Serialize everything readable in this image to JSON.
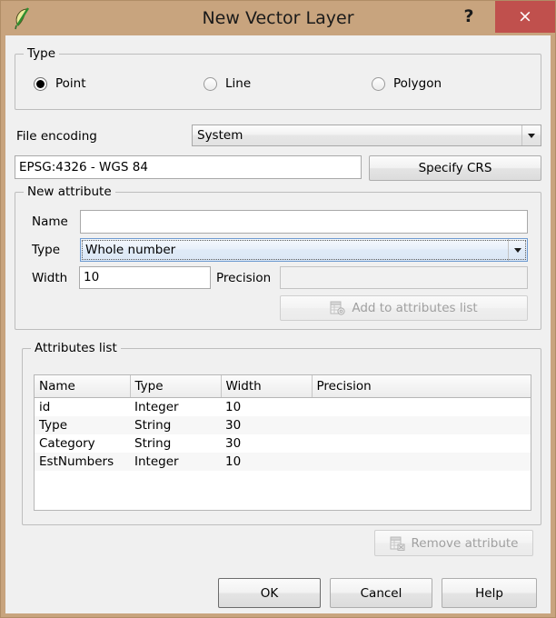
{
  "window": {
    "title": "New Vector Layer",
    "app_icon": "qgis-leaf-icon",
    "help_icon": "?",
    "close_icon": "×",
    "frame_color": "#c8a47e",
    "close_color": "#c0504d"
  },
  "type_group": {
    "title": "Type",
    "options": [
      {
        "label": "Point",
        "checked": true
      },
      {
        "label": "Line",
        "checked": false
      },
      {
        "label": "Polygon",
        "checked": false
      }
    ]
  },
  "encoding": {
    "label": "File encoding",
    "value": "System"
  },
  "crs": {
    "value": "EPSG:4326 - WGS 84",
    "button_label": "Specify CRS"
  },
  "new_attribute": {
    "title": "New attribute",
    "name_label": "Name",
    "name_value": "",
    "name_placeholder": "",
    "type_label": "Type",
    "type_value": "Whole number",
    "width_label": "Width",
    "width_value": "10",
    "precision_label": "Precision",
    "precision_value": "",
    "add_button_label": "Add to attributes list",
    "add_button_icon": "add-table-row-icon",
    "add_button_enabled": false
  },
  "attributes_list": {
    "title": "Attributes list",
    "columns": [
      "Name",
      "Type",
      "Width",
      "Precision"
    ],
    "rows": [
      {
        "name": "id",
        "type": "Integer",
        "width": "10",
        "precision": ""
      },
      {
        "name": "Type",
        "type": "String",
        "width": "30",
        "precision": ""
      },
      {
        "name": "Category",
        "type": "String",
        "width": "30",
        "precision": ""
      },
      {
        "name": "EstNumbers",
        "type": "Integer",
        "width": "10",
        "precision": ""
      }
    ],
    "remove_button_label": "Remove attribute",
    "remove_button_icon": "remove-table-row-icon",
    "remove_button_enabled": false
  },
  "footer": {
    "ok_label": "OK",
    "cancel_label": "Cancel",
    "help_label": "Help"
  }
}
